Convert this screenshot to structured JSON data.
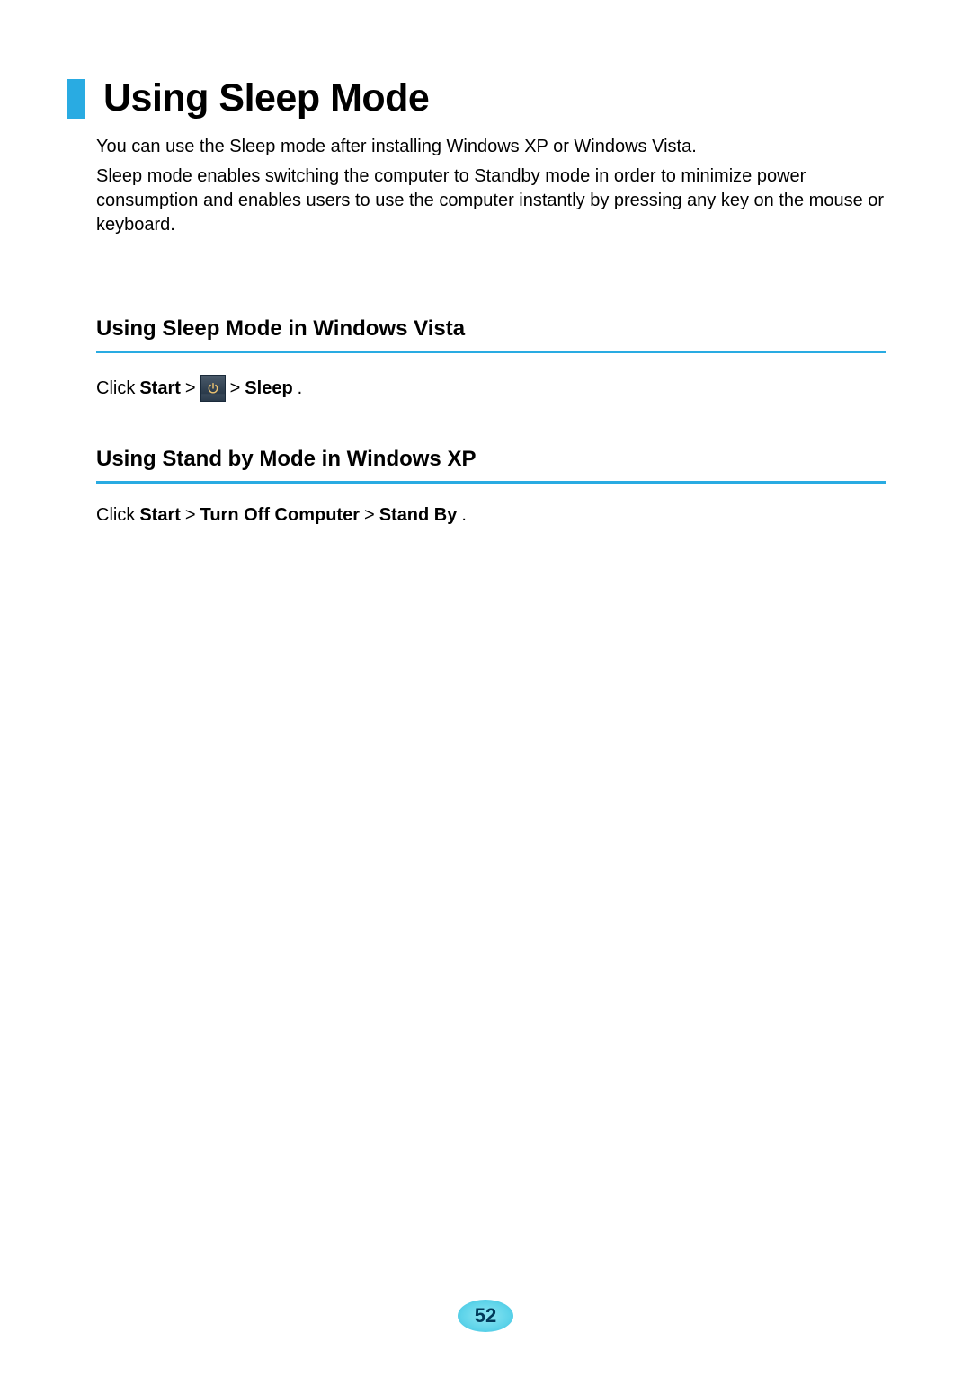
{
  "title": "Using Sleep Mode",
  "intro1": "You can use the Sleep mode after installing Windows XP or Windows Vista.",
  "intro2": "Sleep mode enables switching the computer to Standby mode in order to minimize power consumption and enables users to use the computer instantly by pressing any key on the mouse or keyboard.",
  "vista": {
    "heading": "Using Sleep Mode in Windows Vista",
    "click": "Click ",
    "start": "Start",
    "gt1": " > ",
    "gt2": " > ",
    "sleep": "Sleep",
    "period": "."
  },
  "xp": {
    "heading": "Using Stand by Mode in Windows XP",
    "click": "Click ",
    "start": "Start",
    "gt1": " > ",
    "turnoff": "Turn Off Computer",
    "gt2": " > ",
    "standby": "Stand By",
    "period": "."
  },
  "pageNumber": "52"
}
